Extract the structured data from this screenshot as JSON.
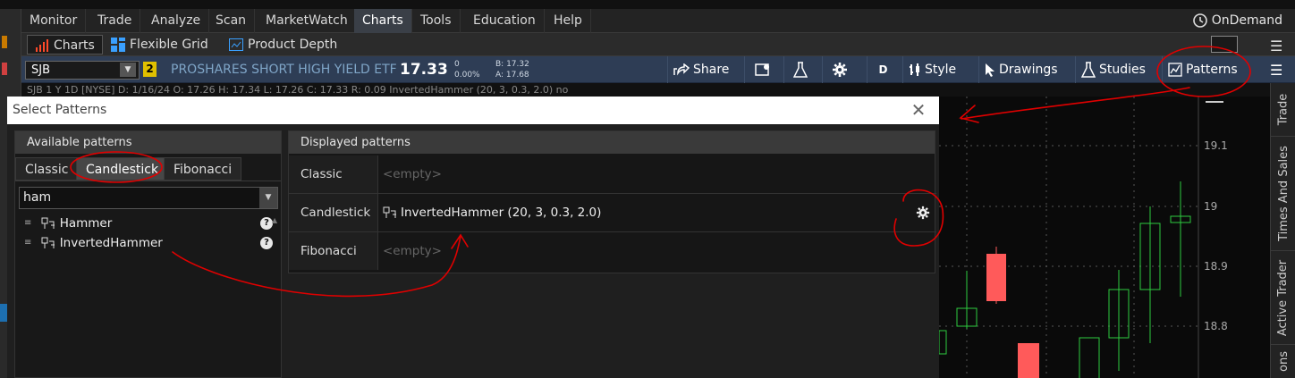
{
  "menubar": {
    "items": [
      "Monitor",
      "Trade",
      "Analyze",
      "Scan",
      "MarketWatch",
      "Charts",
      "Tools",
      "Education",
      "Help"
    ],
    "active": "Charts",
    "ondemand": "OnDemand"
  },
  "subbar": {
    "charts": "Charts",
    "flexible_grid": "Flexible Grid",
    "product_depth": "Product Depth"
  },
  "symbol": {
    "ticker": "SJB",
    "badge": "2",
    "name": "PROSHARES SHORT HIGH YIELD ETF",
    "price": "17.33",
    "change": "0",
    "change_pct": "0.00%",
    "bid": "B: 17.32",
    "ask": "A: 17.68"
  },
  "toolbar": {
    "share": "Share",
    "period": "D",
    "style": "Style",
    "drawings": "Drawings",
    "studies": "Studies",
    "patterns": "Patterns"
  },
  "chart_header": "SJB 1 Y 1D [NYSE]  D: 1/16/24  O: 17.26  H: 17.34  L: 17.26  C: 17.33  R: 0.09  InvertedHammer (20, 3, 0.3, 2.0)  no",
  "chart": {
    "price_labels": [
      "19.1",
      "19",
      "18.9",
      "18.8"
    ]
  },
  "right_tabs": [
    "Trade",
    "Times And Sales",
    "Active Trader",
    "ons"
  ],
  "dialog": {
    "title": "Select Patterns",
    "available": {
      "header": "Available patterns",
      "tabs": [
        "Classic",
        "Candlestick",
        "Fibonacci"
      ],
      "active_tab": "Candlestick",
      "search_value": "ham",
      "patterns": [
        "Hammer",
        "InvertedHammer"
      ]
    },
    "displayed": {
      "header": "Displayed patterns",
      "rows": [
        {
          "label": "Classic",
          "value": "<empty>"
        },
        {
          "label": "Candlestick",
          "value": "InvertedHammer (20, 3, 0.3, 2.0)"
        },
        {
          "label": "Fibonacci",
          "value": "<empty>"
        }
      ]
    }
  },
  "colors": {
    "up": "#2ecc40",
    "down": "#ff5a5a",
    "annotation": "#e00000",
    "symbar": "#2e3d55"
  }
}
